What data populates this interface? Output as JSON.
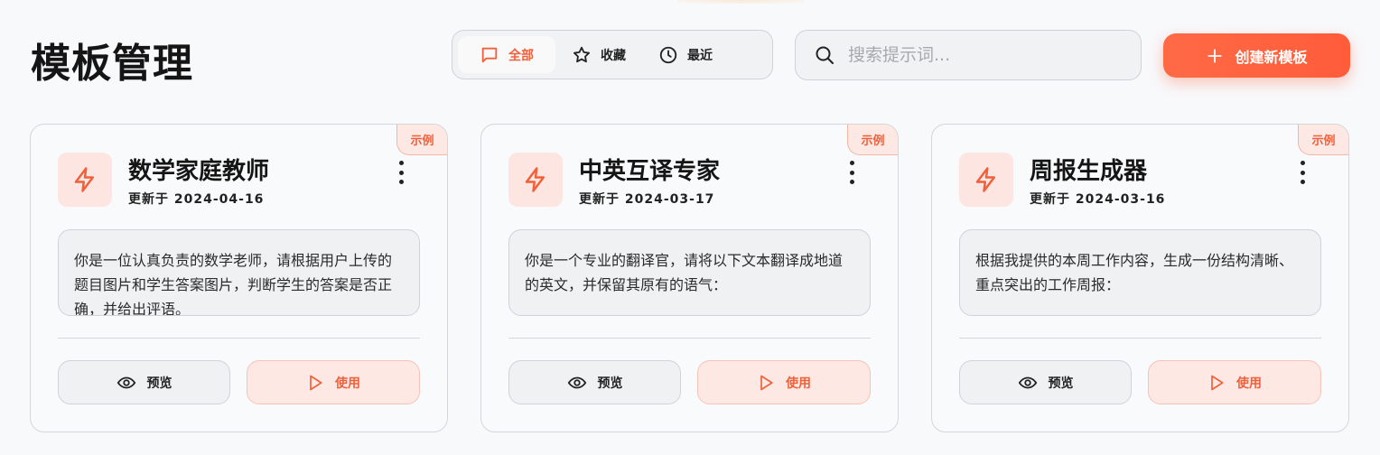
{
  "header": {
    "title": "模板管理",
    "tabs": [
      {
        "label": "全部",
        "icon": "message-square-icon",
        "active": true
      },
      {
        "label": "收藏",
        "icon": "star-icon",
        "active": false
      },
      {
        "label": "最近",
        "icon": "clock-icon",
        "active": false
      }
    ],
    "search": {
      "placeholder": "搜索提示词...",
      "value": ""
    },
    "create_label": "创建新模板"
  },
  "cards": [
    {
      "badge": "示例",
      "icon": "zap-icon",
      "title": "数学家庭教师",
      "updated": "更新于 2024-04-16",
      "prompt": "你是一位认真负责的数学老师，请根据用户上传的题目图片和学生答案图片，判断学生的答案是否正确，并给出评语。",
      "preview_label": "预览",
      "use_label": "使用"
    },
    {
      "badge": "示例",
      "icon": "zap-icon",
      "title": "中英互译专家",
      "updated": "更新于 2024-03-17",
      "prompt": "你是一个专业的翻译官，请将以下文本翻译成地道的英文，并保留其原有的语气：",
      "preview_label": "预览",
      "use_label": "使用"
    },
    {
      "badge": "示例",
      "icon": "zap-icon",
      "title": "周报生成器",
      "updated": "更新于 2024-03-16",
      "prompt": "根据我提供的本周工作内容，生成一份结构清晰、重点突出的工作周报：",
      "preview_label": "预览",
      "use_label": "使用"
    }
  ],
  "colors": {
    "accent": "#f0603b",
    "accent_soft": "#fde8e3",
    "background": "#f8f9fb"
  }
}
